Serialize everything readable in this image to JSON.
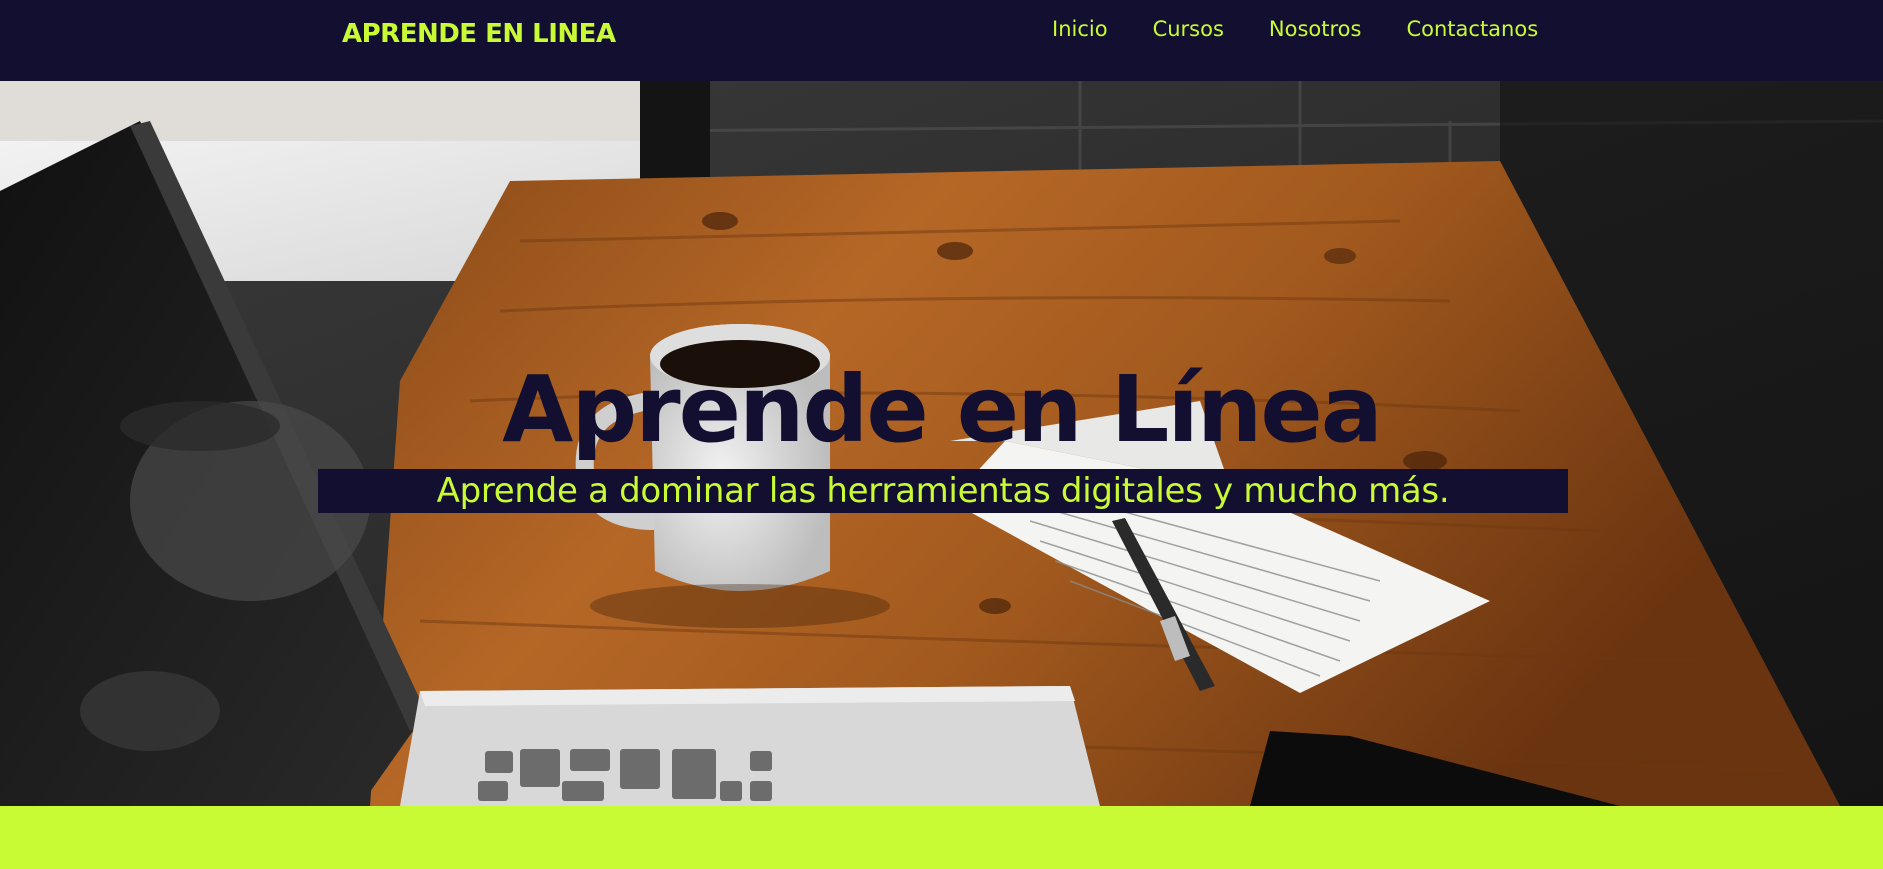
{
  "colors": {
    "primary_dark": "#130f31",
    "accent_lime": "#c9fb35"
  },
  "header": {
    "brand": "APRENDE EN LINEA",
    "nav": [
      {
        "label": "Inicio"
      },
      {
        "label": "Cursos"
      },
      {
        "label": "Nosotros"
      },
      {
        "label": "Contactanos"
      }
    ]
  },
  "hero": {
    "title": "Aprende en Línea",
    "subtitle": "Aprende a dominar las herramientas digitales y mucho más.",
    "background_image": "desk-laptop-coffee-notebook-photo"
  }
}
